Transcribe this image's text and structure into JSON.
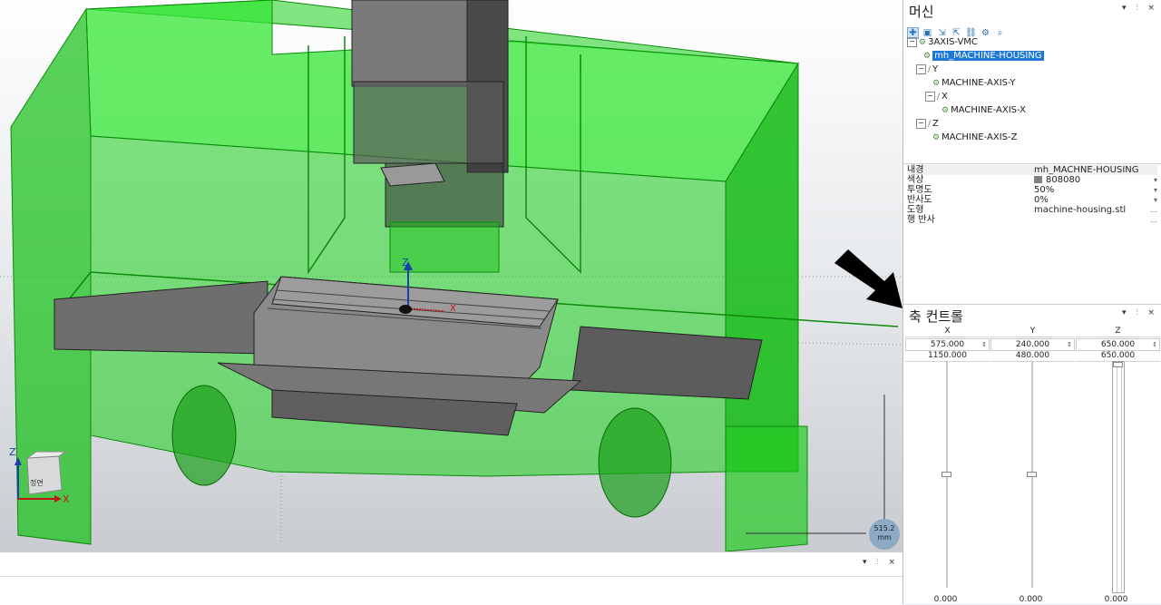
{
  "viewport": {
    "axis_z": "Z",
    "axis_x": "X",
    "triad_z": "Z",
    "triad_x": "X",
    "cube_label": "정면",
    "measure_value": "515.2",
    "measure_unit": "mm"
  },
  "machine_panel": {
    "title": "머신",
    "ctrls": "▾ ⫶ ×",
    "toolbar_icons": [
      "add-axis-icon",
      "add-component-icon",
      "import-icon",
      "export-icon",
      "link-icon",
      "settings-icon",
      "find-icon"
    ],
    "tree": [
      {
        "label": "3AXIS-VMC",
        "depth": 0,
        "expanded": true,
        "selected": false
      },
      {
        "label": "mh_MACHINE-HOUSING",
        "depth": 1,
        "expanded": false,
        "selected": true
      },
      {
        "label": "Y",
        "depth": 1,
        "expanded": true,
        "selected": false
      },
      {
        "label": "MACHINE-AXIS-Y",
        "depth": 2,
        "expanded": false,
        "selected": false
      },
      {
        "label": "X",
        "depth": 2,
        "expanded": true,
        "selected": false
      },
      {
        "label": "MACHINE-AXIS-X",
        "depth": 3,
        "expanded": false,
        "selected": false
      },
      {
        "label": "Z",
        "depth": 1,
        "expanded": true,
        "selected": false
      },
      {
        "label": "MACHINE-AXIS-Z",
        "depth": 2,
        "expanded": false,
        "selected": false
      }
    ]
  },
  "properties": [
    {
      "key": "내경",
      "value": "mh_MACHNE-HOUSING",
      "dd": "",
      "hl": true
    },
    {
      "key": "색상",
      "value": "808080",
      "dd": "▾",
      "swatch": true,
      "hl": false
    },
    {
      "key": "투명도",
      "value": "50%",
      "dd": "▾",
      "hl": false
    },
    {
      "key": "반사도",
      "value": "0%",
      "dd": "▾",
      "hl": false
    },
    {
      "key": "도형",
      "value": "machine-housing.stl",
      "dd": "…",
      "hl": false
    },
    {
      "key": "행 반사",
      "value": "",
      "dd": "…",
      "hl": false
    }
  ],
  "axis_control": {
    "title": "축 컨트롤",
    "ctrls": "▾ ⫶ ×",
    "columns": [
      {
        "name": "X",
        "value": "575.000",
        "max": "1150.000",
        "bottom": "0.000",
        "thumb_frac": 0.5
      },
      {
        "name": "Y",
        "value": "240.000",
        "max": "480.000",
        "bottom": "0.000",
        "thumb_frac": 0.5
      },
      {
        "name": "Z",
        "value": "650.000",
        "max": "650.000",
        "bottom": "0.000",
        "thumb_frac": 1.0
      }
    ]
  },
  "bottom_panel": {
    "ctrls": "▾ ⫶ ×"
  }
}
